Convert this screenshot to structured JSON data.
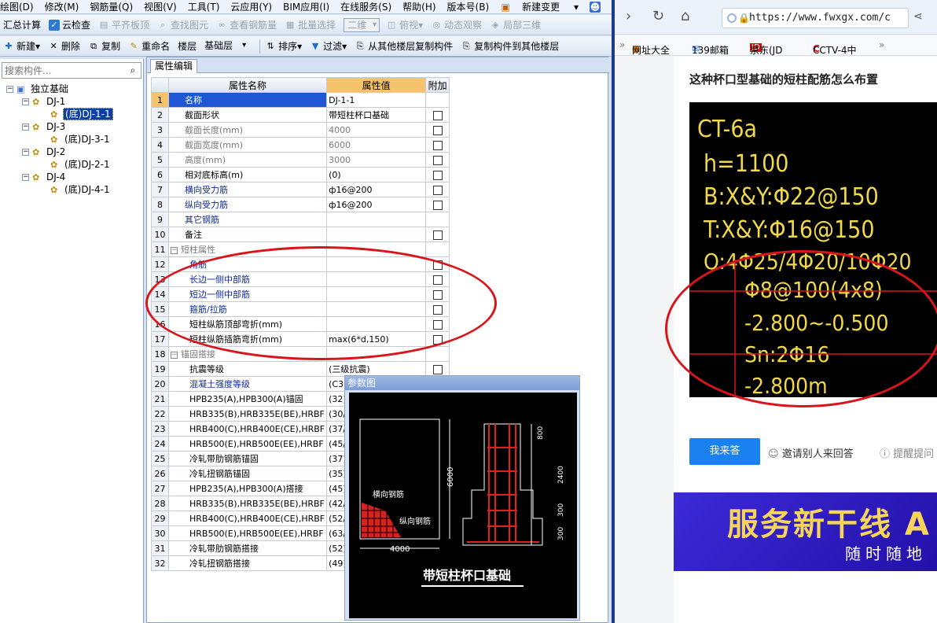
{
  "menu": [
    "绘图(D)",
    "修改(M)",
    "钢筋量(Q)",
    "视图(V)",
    "工具(T)",
    "云应用(Y)",
    "BIM应用(I)",
    "在线服务(S)",
    "帮助(H)",
    "版本号(B)",
    "新建变更",
    "登录"
  ],
  "toolbar1": {
    "summary": "汇总计算",
    "cloud_check": "云检查",
    "flat_slab": "平齐板顶",
    "find_element": "查找图元",
    "view_rebar": "查看钢筋量",
    "batch_select": "批量选择",
    "view_mode": "二维",
    "top_view": "俯视",
    "dynamic": "动态观察",
    "local_3d": "局部三维"
  },
  "toolbar2": {
    "new": "新建",
    "delete": "删除",
    "copy": "复制",
    "rename": "重命名",
    "floor_label": "楼层",
    "floor_value": "基础层",
    "sort": "排序",
    "filter": "过滤",
    "copy_from": "从其他楼层复制构件",
    "copy_to": "复制构件到其他楼层"
  },
  "sidebar": {
    "search_placeholder": "搜索构件...",
    "root": "独立基础",
    "groups": [
      {
        "name": "DJ-1",
        "child": "(底)DJ-1-1"
      },
      {
        "name": "DJ-3",
        "child": "(底)DJ-3-1"
      },
      {
        "name": "DJ-2",
        "child": "(底)DJ-2-1"
      },
      {
        "name": "DJ-4",
        "child": "(底)DJ-4-1"
      }
    ]
  },
  "editor": {
    "tab": "属性编辑",
    "headers": [
      "属性名称",
      "属性值",
      "附加"
    ],
    "rows": [
      {
        "n": "1",
        "name": "名称",
        "value": "DJ-1-1",
        "style": "cur",
        "cb": false
      },
      {
        "n": "2",
        "name": "截面形状",
        "value": "带短柱杯口基础",
        "style": "",
        "cb": true
      },
      {
        "n": "3",
        "name": "截面长度(mm)",
        "value": "4000",
        "style": "gray",
        "cb": true
      },
      {
        "n": "4",
        "name": "截面宽度(mm)",
        "value": "6000",
        "style": "gray",
        "cb": true
      },
      {
        "n": "5",
        "name": "高度(mm)",
        "value": "3000",
        "style": "gray",
        "cb": true
      },
      {
        "n": "6",
        "name": "相对底标高(m)",
        "value": "(0)",
        "style": "",
        "cb": true
      },
      {
        "n": "7",
        "name": "横向受力筋",
        "value": "ф16@200",
        "style": "blue",
        "cb": true
      },
      {
        "n": "8",
        "name": "纵向受力筋",
        "value": "ф16@200",
        "style": "blue",
        "cb": true
      },
      {
        "n": "9",
        "name": "其它钢筋",
        "value": "",
        "style": "blue",
        "cb": false
      },
      {
        "n": "10",
        "name": "备注",
        "value": "",
        "style": "",
        "cb": true
      },
      {
        "n": "11",
        "name": "短柱属性",
        "value": "",
        "style": "group",
        "cb": false
      },
      {
        "n": "12",
        "name": "角筋",
        "value": "",
        "style": "blue-ind",
        "cb": true
      },
      {
        "n": "13",
        "name": "长边一侧中部筋",
        "value": "",
        "style": "blue-ind",
        "cb": true
      },
      {
        "n": "14",
        "name": "短边一侧中部筋",
        "value": "",
        "style": "blue-ind",
        "cb": true
      },
      {
        "n": "15",
        "name": "箍筋/拉筋",
        "value": "",
        "style": "blue-ind",
        "cb": true
      },
      {
        "n": "16",
        "name": "短柱纵筋顶部弯折(mm)",
        "value": "",
        "style": "ind",
        "cb": true
      },
      {
        "n": "17",
        "name": "短柱纵筋插筋弯折(mm)",
        "value": "max(6*d,150)",
        "style": "ind",
        "cb": true
      },
      {
        "n": "18",
        "name": "锚固搭接",
        "value": "",
        "style": "group",
        "cb": false
      },
      {
        "n": "19",
        "name": "抗震等级",
        "value": "(三级抗震)",
        "style": "ind",
        "cb": true
      },
      {
        "n": "20",
        "name": "混凝土强度等级",
        "value": "(C30)",
        "style": "blue-ind",
        "cb": false
      },
      {
        "n": "21",
        "name": "HPB235(A),HPB300(A)锚固",
        "value": "(32)",
        "style": "ind",
        "cb": false
      },
      {
        "n": "22",
        "name": "HRB335(B),HRB335E(BE),HRBF",
        "value": "(30/3",
        "style": "ind",
        "cb": false
      },
      {
        "n": "23",
        "name": "HRB400(C),HRB400E(CE),HRBF",
        "value": "(37/4",
        "style": "ind",
        "cb": false
      },
      {
        "n": "24",
        "name": "HRB500(E),HRB500E(EE),HRBF",
        "value": "(45/4",
        "style": "ind",
        "cb": false
      },
      {
        "n": "25",
        "name": "冷轧带肋钢筋锚固",
        "value": "(37)",
        "style": "ind",
        "cb": false
      },
      {
        "n": "26",
        "name": "冷轧扭钢筋锚固",
        "value": "(35)",
        "style": "ind",
        "cb": false
      },
      {
        "n": "27",
        "name": "HPB235(A),HPB300(A)搭接",
        "value": "(45)",
        "style": "ind",
        "cb": false
      },
      {
        "n": "28",
        "name": "HRB335(B),HRB335E(BE),HRBF",
        "value": "(42/4",
        "style": "ind",
        "cb": false
      },
      {
        "n": "29",
        "name": "HRB400(C),HRB400E(CE),HRBF",
        "value": "(52/5",
        "style": "ind",
        "cb": false
      },
      {
        "n": "30",
        "name": "HRB500(E),HRB500E(EE),HRBF",
        "value": "(63/6",
        "style": "ind",
        "cb": false
      },
      {
        "n": "31",
        "name": "冷轧带肋钢筋搭接",
        "value": "(52)",
        "style": "ind",
        "cb": false
      },
      {
        "n": "32",
        "name": "冷轧扭钢筋搭接",
        "value": "(49)",
        "style": "ind",
        "cb": false
      }
    ]
  },
  "param_window": {
    "title": "参数图",
    "dim_width": "4000",
    "dim_height": "6000",
    "label_horizontal": "横向钢筋",
    "label_vertical": "纵向钢筋",
    "dim_800": "800",
    "dim_2400": "2400",
    "dim_300a": "300",
    "dim_300b": "300",
    "caption": "带短柱杯口基础"
  },
  "browser": {
    "url": "https://www.fwxgx.com/c",
    "bookmarks": [
      "网址大全",
      "139邮箱",
      "京东(JD",
      "CCTV-4中"
    ],
    "question_title": "这种杯口型基础的短柱配筋怎么布置",
    "cad_lines": [
      "CT-6a",
      "h=1100",
      "B:X&Y:Φ22@150",
      "T:X&Y:Φ16@150",
      "O:4Φ25/4Φ20/10Φ20",
      "Φ8@100(4x8)",
      "-2.800~-0.500",
      "Sn:2Φ16",
      "-2.800m"
    ],
    "answer_button": "我来答",
    "invite": "邀请别人来回答",
    "remind": "提醒提问",
    "banner_title": "服务新干线 A",
    "banner_sub": "随时随地"
  },
  "colors": {
    "accent": "#1a82f0",
    "highlight": "#f4c36b",
    "annotation": "#d8151b",
    "cad_text": "#f0d84a"
  }
}
